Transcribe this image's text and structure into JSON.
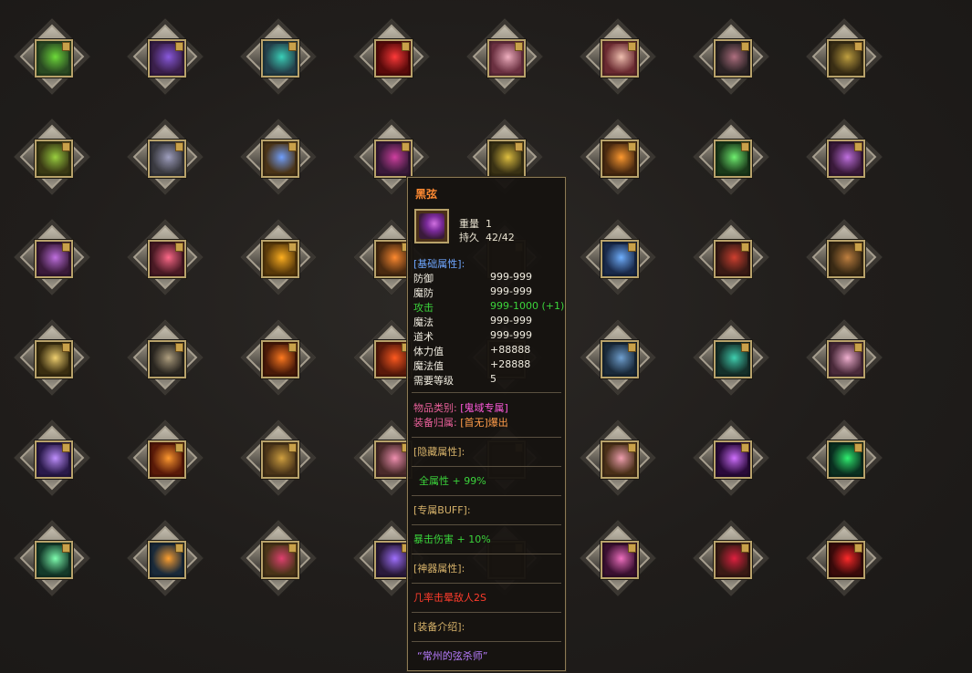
{
  "grid": {
    "items": [
      {
        "name": "item-1",
        "color": "#2a4a22",
        "accent": "#6edc3a"
      },
      {
        "name": "item-2",
        "color": "#3a1f4a",
        "accent": "#8a5adf"
      },
      {
        "name": "item-3",
        "color": "#24404a",
        "accent": "#3ad0b8"
      },
      {
        "name": "item-4",
        "color": "#5a0a0a",
        "accent": "#ff3a3a"
      },
      {
        "name": "item-5",
        "color": "#6a3040",
        "accent": "#f0b0c0"
      },
      {
        "name": "item-6",
        "color": "#6a2a30",
        "accent": "#f0c0b0"
      },
      {
        "name": "item-7",
        "color": "#2a2224",
        "accent": "#b07080"
      },
      {
        "name": "item-8",
        "color": "#3a2e14",
        "accent": "#c0a040"
      },
      {
        "name": "item-9",
        "color": "#3a3a14",
        "accent": "#9ad040"
      },
      {
        "name": "item-10",
        "color": "#3a3a40",
        "accent": "#a0a0c0"
      },
      {
        "name": "item-11",
        "color": "#4a3418",
        "accent": "#70a0ff"
      },
      {
        "name": "item-12",
        "color": "#3a1a3a",
        "accent": "#d040a0"
      },
      {
        "name": "item-13",
        "color": "#3a3214",
        "accent": "#e0c040"
      },
      {
        "name": "item-14",
        "color": "#4a2a10",
        "accent": "#ff9a30"
      },
      {
        "name": "item-15",
        "color": "#1a3a1a",
        "accent": "#70f070"
      },
      {
        "name": "item-16",
        "color": "#3a1a3a",
        "accent": "#c070e0"
      },
      {
        "name": "item-17",
        "color": "#3a1a3a",
        "accent": "#c070e0"
      },
      {
        "name": "item-18",
        "color": "#4a1a24",
        "accent": "#ff6a8a"
      },
      {
        "name": "item-19",
        "color": "#5a3a0a",
        "accent": "#ffb020"
      },
      {
        "name": "item-20",
        "color": "#4a2a10",
        "accent": "#ff8a30"
      },
      {
        "name": "item-21",
        "color": "#4a3418",
        "accent": "#4a3418"
      },
      {
        "name": "item-22",
        "color": "#1a2a4a",
        "accent": "#70b0ff"
      },
      {
        "name": "item-23",
        "color": "#3a1a14",
        "accent": "#d04030"
      },
      {
        "name": "item-24",
        "color": "#3a2a14",
        "accent": "#c08040"
      },
      {
        "name": "item-25",
        "color": "#3a2e10",
        "accent": "#f0d070"
      },
      {
        "name": "item-26",
        "color": "#2a2620",
        "accent": "#b0a080"
      },
      {
        "name": "item-27",
        "color": "#4a1a08",
        "accent": "#ff7a20"
      },
      {
        "name": "item-28",
        "color": "#5a1a0a",
        "accent": "#ff5a20"
      },
      {
        "name": "item-29",
        "color": "#4a3418",
        "accent": "#4a3418"
      },
      {
        "name": "item-30",
        "color": "#1a2a3a",
        "accent": "#70a0d0"
      },
      {
        "name": "item-31",
        "color": "#14302a",
        "accent": "#40d0b0"
      },
      {
        "name": "item-32",
        "color": "#4a2a3a",
        "accent": "#f0b0d0"
      },
      {
        "name": "item-33",
        "color": "#2a1a4a",
        "accent": "#c090ff"
      },
      {
        "name": "item-34",
        "color": "#5a1a08",
        "accent": "#ff9a30"
      },
      {
        "name": "item-35",
        "color": "#4a3418",
        "accent": "#d0a040"
      },
      {
        "name": "item-36",
        "color": "#4a2a2a",
        "accent": "#f090b0"
      },
      {
        "name": "item-37",
        "color": "#4a3418",
        "accent": "#4a3418"
      },
      {
        "name": "item-38",
        "color": "#4a3018",
        "accent": "#f0a0b0"
      },
      {
        "name": "item-39",
        "color": "#2a0a3a",
        "accent": "#d070ff"
      },
      {
        "name": "item-40",
        "color": "#0a3020",
        "accent": "#30f070"
      },
      {
        "name": "item-41",
        "color": "#143a2a",
        "accent": "#80ffb0"
      },
      {
        "name": "item-42",
        "color": "#1a2a3a",
        "accent": "#ffa030"
      },
      {
        "name": "item-43",
        "color": "#4a3418",
        "accent": "#e04070"
      },
      {
        "name": "item-44",
        "color": "#2a1a3a",
        "accent": "#a070ff"
      },
      {
        "name": "item-45",
        "color": "#4a3418",
        "accent": "#4a3418"
      },
      {
        "name": "item-46",
        "color": "#3a1030",
        "accent": "#f070c0"
      },
      {
        "name": "item-47",
        "color": "#3a1a14",
        "accent": "#e02040"
      },
      {
        "name": "item-48",
        "color": "#3a0a0a",
        "accent": "#ff2a2a"
      }
    ]
  },
  "tooltip": {
    "title": "黑弦",
    "icon": "bow-weapon-icon",
    "weight_label": "重量",
    "weight_value": "1",
    "durability_label": "持久",
    "durability_value": "42/42",
    "base_header": "[基础属性]:",
    "stats": [
      {
        "label": "防御",
        "value": "999-999",
        "color": "white"
      },
      {
        "label": "魔防",
        "value": "999-999",
        "color": "white"
      },
      {
        "label": "攻击",
        "value": "999-1000 (+1)",
        "color": "green"
      },
      {
        "label": "魔法",
        "value": "999-999",
        "color": "white"
      },
      {
        "label": "道术",
        "value": "999-999",
        "color": "white"
      },
      {
        "label": "体力值",
        "value": "+88888",
        "color": "white"
      },
      {
        "label": "魔法值",
        "value": "+28888",
        "color": "white"
      },
      {
        "label": "需要等级",
        "value": "5",
        "color": "white"
      }
    ],
    "category_label": "物品类别:",
    "category_value": "[鬼域专属]",
    "owner_label": "装备归属:",
    "owner_value": "[首无]爆出",
    "hidden_header": "[隐藏属性]:",
    "hidden_value": "全属性 + 99%",
    "buff_header": "[专属BUFF]:",
    "buff_value": "暴击伤害 + 10%",
    "artifact_header": "[神器属性]:",
    "artifact_value": "几率击晕敌人2S",
    "intro_header": "[装备介绍]:",
    "intro_value": "“常州的弦杀师”"
  }
}
